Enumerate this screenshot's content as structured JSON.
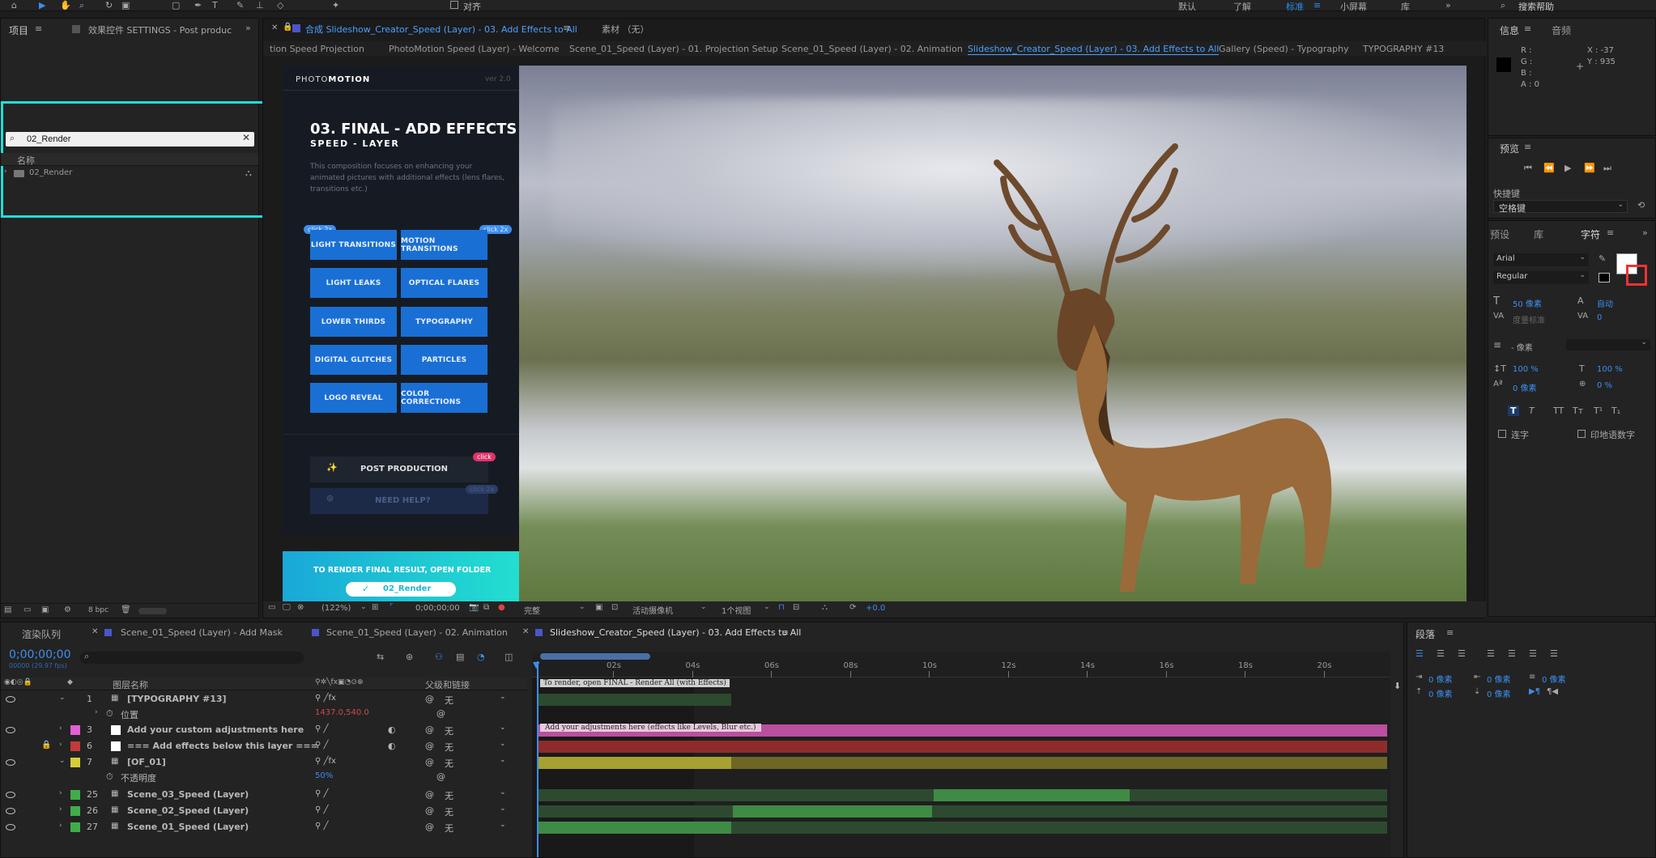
{
  "toolbar": {
    "align_label": "对齐",
    "ws_default": "默认",
    "ws_learn": "了解",
    "ws_standard": "标准",
    "ws_small": "小屏幕",
    "ws_library": "库",
    "search_help": "搜索帮助"
  },
  "project": {
    "tab_label": "项目",
    "effects_tab": "效果控件 SETTINGS - Post produc",
    "search_value": "02_Render",
    "col_name": "名称",
    "item_name": "02_Render",
    "bpc": "8 bpc"
  },
  "comp": {
    "title": "合成 Slideshow_Creator_Speed (Layer) - 03. Add Effects to All",
    "footage_tab": "素材 （无）",
    "breadcrumbs": [
      "tion Speed Projection",
      "PhotoMotion Speed (Layer) - Welcome",
      "Scene_01_Speed (Layer) - 01. Projection Setup",
      "Scene_01_Speed (Layer) - 02. Animation",
      "Slideshow_Creator_Speed (Layer) - 03. Add Effects to All",
      "Gallery (Speed) - Typography",
      "TYPOGRAPHY #13"
    ]
  },
  "overlay": {
    "logo_a": "PHOTO",
    "logo_b": "MOTION",
    "version": "ver 2.0",
    "heading": "03. FINAL - ADD EFFECTS",
    "subheading": "SPEED - LAYER",
    "desc": "This composition focuses on enhancing your animated pictures with additional effects (lens flares, transitions etc.)",
    "badge": "click 2x",
    "buttons": [
      "LIGHT TRANSITIONS",
      "MOTION TRANSITIONS",
      "LIGHT LEAKS",
      "OPTICAL FLARES",
      "LOWER THIRDS",
      "TYPOGRAPHY",
      "DIGITAL GLITCHES",
      "PARTICLES",
      "LOGO REVEAL",
      "COLOR CORRECTIONS"
    ],
    "post": "POST PRODUCTION",
    "post_badge": "click",
    "help": "NEED HELP?",
    "help_badge": "click 2x",
    "render_text": "TO RENDER FINAL RESULT, OPEN FOLDER",
    "render_btn": "02_Render"
  },
  "viewer": {
    "zoom": "(122%)",
    "timecode": "0;00;00;00",
    "quality": "完整",
    "camera": "活动摄像机",
    "views": "1个视图",
    "exposure": "+0.0"
  },
  "info": {
    "tab": "信息",
    "audio_tab": "音频",
    "r": "R :",
    "g": "G :",
    "b": "B :",
    "a": "A : 0",
    "x": "X : -37",
    "y": "Y : 935"
  },
  "preview": {
    "tab": "预览",
    "shortcut_label": "快捷键",
    "shortcut_value": "空格键"
  },
  "character": {
    "tab_presets": "预设",
    "tab_library": "库",
    "tab_char": "字符",
    "font": "Arial",
    "style": "Regular",
    "size": "50 像素",
    "leading": "自动",
    "kerning": "度量标准",
    "tracking": "0",
    "stroke": "- 像素",
    "vscale": "100 %",
    "hscale": "100 %",
    "baseline": "0 像素",
    "tsume": "0 %",
    "ligatures": "连字",
    "hindi": "印地语数字"
  },
  "timeline": {
    "tab_render": "渲染队列",
    "tab1": "Scene_01_Speed (Layer) - Add Mask",
    "tab2": "Scene_01_Speed (Layer) - 02. Animation",
    "tab3": "Slideshow_Creator_Speed (Layer) - 03. Add Effects to All",
    "timecode": "0;00;00;00",
    "fps": "00000 (29.97 fps)",
    "col_layer": "图层名称",
    "col_parent": "父级和链接",
    "ticks": [
      "02s",
      "04s",
      "06s",
      "08s",
      "10s",
      "12s",
      "14s",
      "16s",
      "18s",
      "20s"
    ],
    "layers": [
      {
        "num": "1",
        "name": "[TYPOGRAPHY #13]",
        "parent": "无",
        "color": "#d86ec5"
      },
      {
        "num": "",
        "name": "位置",
        "value": "1437.0,540.0"
      },
      {
        "num": "3",
        "name": "Add your custom adjustments here",
        "parent": "无",
        "color": "#e45fd3"
      },
      {
        "num": "6",
        "name": "=== Add effects below this layer ===",
        "parent": "无",
        "color": "#c43a3a"
      },
      {
        "num": "7",
        "name": "[OF_01]",
        "parent": "无",
        "color": "#d6cc3a"
      },
      {
        "num": "",
        "name": "不透明度",
        "value": "50%"
      },
      {
        "num": "25",
        "name": "Scene_03_Speed (Layer)",
        "parent": "无",
        "color": "#3fae4a"
      },
      {
        "num": "26",
        "name": "Scene_02_Speed (Layer)",
        "parent": "无",
        "color": "#3fae4a"
      },
      {
        "num": "27",
        "name": "Scene_01_Speed (Layer)",
        "parent": "无",
        "color": "#3fae4a"
      }
    ],
    "marker1": "To render, open FINAL - Render All (with Effects)",
    "marker2": "Add your adjustments here (effects like Levels, Blur etc.)"
  },
  "paragraph": {
    "tab": "段落",
    "indent_l": "0 像素",
    "indent_r": "0 像素",
    "indent_f": "0 像素",
    "space_b": "0 像素",
    "space_a": "0 像素"
  },
  "colors": {
    "accent": "#2d8ceb",
    "cyan": "#1ee0d8",
    "panel": "#232323"
  }
}
